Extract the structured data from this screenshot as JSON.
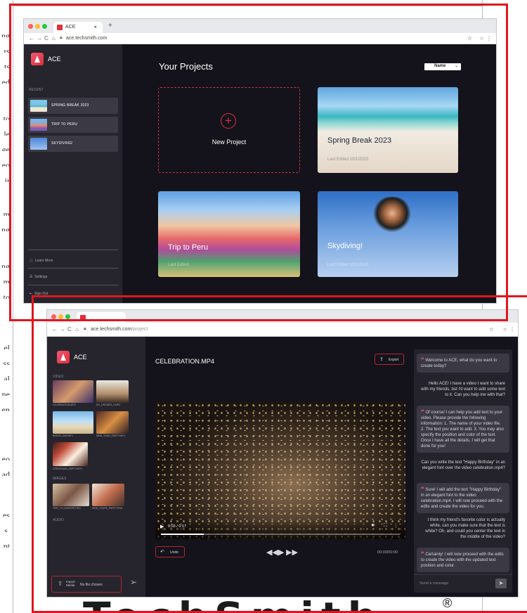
{
  "background_doc": {
    "line_fragments": [
      "ng",
      "rs",
      "ts",
      "ed",
      "to",
      "le",
      "ge",
      "eo",
      "ir",
      "m",
      "ng",
      "ng",
      "m",
      "to",
      "el",
      "ss",
      "al",
      "ne",
      "en",
      "eo",
      "ad",
      "es",
      "s.",
      "nt"
    ],
    "footer_wordmark": "TechSmith",
    "footer_reg": "®"
  },
  "top_browser": {
    "tab_title": "ACE",
    "tab_close": "×",
    "new_tab": "+",
    "url": "ace.techsmith.com",
    "app": {
      "brand": "ACE",
      "sidebar": {
        "recent_label": "RECENT",
        "recent_items": [
          "SPRING BREAK 2023",
          "TRIP TO PERU",
          "SKYDIVING!"
        ],
        "learn_more": "Learn More",
        "settings": "Settings",
        "sign_out": "Sign Out"
      },
      "main": {
        "heading": "Your Projects",
        "sort_value": "Name",
        "new_project": "New Project",
        "cards": [
          {
            "title": "Spring Break 2023",
            "sub": "Last Edited 10/1/2023"
          },
          {
            "title": "Trip to Peru",
            "sub": "Last Edited"
          },
          {
            "title": "Skydiving!",
            "sub": "Last Edited 10/1/2023"
          }
        ]
      }
    }
  },
  "bottom_browser": {
    "url_host": "ace.techsmith.com",
    "url_path": "/project",
    "app": {
      "brand": "ACE",
      "sections": {
        "video": "VIDEO",
        "images": "IMAGES",
        "audio": "AUDIO"
      },
      "videos": [
        "CELEBRATION.MP4",
        "MY_DRONES_2.MP4",
        "BEACH_DAY.MP4",
        "NEW_YEAR_PARTY.MP4",
        "CHRISTMAS_PARTY.MP4"
      ],
      "images": [
        "TRIP_TO_EUROPE.PNG",
        "NEW_YEARS_PARTY.PNG"
      ],
      "import_label": "Import Media",
      "no_file": "No file chosen",
      "file_title": "CELEBRATION.MP4",
      "export_label": "Export",
      "time_current": "0:03 / 0:17",
      "undo_label": "Undo",
      "timecode": "00:00/00:00",
      "chat": {
        "messages": [
          {
            "role": "ai",
            "text": "Welcome to ACE, what do you want to create today?"
          },
          {
            "role": "user",
            "text": "Hello ACE! I have a video I want to share with my friends, but I'd want to add some text to it. Can you help me with that?"
          },
          {
            "role": "ai",
            "text": "Of course! I can help you add text to your video. Please provide the following information: 1. The name of your video file. 2. The text you want to add. 3. You may also specify the position and color of the text. Once I have all the details, I will get that done for you!"
          },
          {
            "role": "user",
            "text": "Can you write the text \"Happy Birthday\" in an elegant font over the video celebration.mp4?"
          },
          {
            "role": "ai",
            "text": "Sure! I will add the text \"Happy Birthday\" in an elegant font to the video celebration.mp4. I will now proceed with the edits and create the video for you."
          },
          {
            "role": "user",
            "text": "I think my friend's favorite color is actually white, can you make sure that the text is white? Oh, and could you center the text in the middle of the video?"
          },
          {
            "role": "ai",
            "text": "Certainly! I will now proceed with the edits to create the video with the updated text position and color."
          }
        ],
        "placeholder": "Send a message"
      }
    }
  },
  "colors": {
    "accent": "#e0303e",
    "frame_red": "#e0161e",
    "app_bg": "#14131b",
    "sidebar_bg": "#26252d"
  },
  "icons": [
    "plus-circle-icon",
    "info-icon",
    "settings-icon",
    "sign-out-icon",
    "upload-icon",
    "send-icon",
    "export-icon",
    "undo-icon",
    "rewind-icon",
    "play-icon",
    "forward-icon",
    "volume-icon",
    "fullscreen-icon",
    "more-icon"
  ]
}
